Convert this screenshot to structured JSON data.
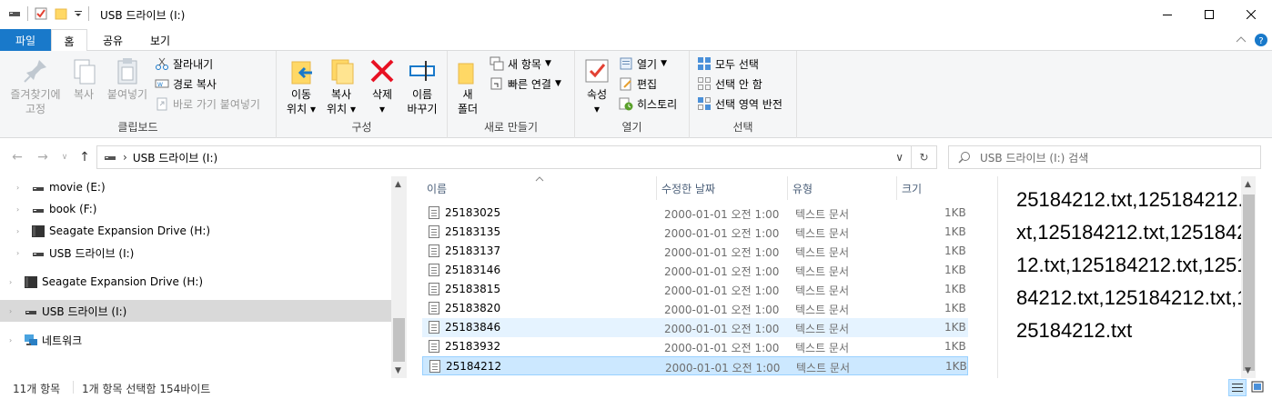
{
  "window": {
    "title": "USB 드라이브 (I:)"
  },
  "ribbon_tabs": [
    {
      "label": "파일"
    },
    {
      "label": "홈"
    },
    {
      "label": "공유"
    },
    {
      "label": "보기"
    }
  ],
  "clipboard": {
    "pin_label": "즐겨찾기에\n고정",
    "pin_line1": "즐겨찾기에",
    "pin_line2": "고정",
    "copy_label": "복사",
    "paste_label": "붙여넣기",
    "cut_label": "잘라내기",
    "copy_path_label": "경로 복사",
    "paste_shortcut_label": "바로 가기 붙여넣기",
    "group_label": "클립보드"
  },
  "organize": {
    "move_line1": "이동",
    "move_line2": "위치",
    "copyto_line1": "복사",
    "copyto_line2": "위치",
    "delete_label": "삭제",
    "rename_line1": "이름",
    "rename_line2": "바꾸기",
    "group_label": "구성"
  },
  "new": {
    "folder_line1": "새",
    "folder_line2": "폴더",
    "new_item_label": "새 항목",
    "easy_access_label": "빠른 연결",
    "group_label": "새로 만들기"
  },
  "open": {
    "properties_label": "속성",
    "open_label": "열기",
    "edit_label": "편집",
    "history_label": "히스토리",
    "group_label": "열기"
  },
  "select": {
    "select_all_label": "모두 선택",
    "select_none_label": "선택 안 함",
    "invert_label": "선택 영역 반전",
    "group_label": "선택"
  },
  "address": {
    "path": "USB 드라이브 (I:)",
    "search_placeholder": "USB 드라이브 (I:) 검색"
  },
  "nav_items": [
    {
      "label": "movie (E:)",
      "icon": "drive-icon"
    },
    {
      "label": "book (F:)",
      "icon": "drive-icon"
    },
    {
      "label": "Seagate Expansion Drive (H:)",
      "icon": "external-drive-icon"
    },
    {
      "label": "USB 드라이브 (I:)",
      "icon": "drive-icon"
    },
    {
      "label": "Seagate Expansion Drive (H:)",
      "icon": "external-drive-icon"
    },
    {
      "label": "USB 드라이브 (I:)",
      "icon": "drive-icon"
    },
    {
      "label": "네트워크",
      "icon": "network-icon"
    }
  ],
  "columns": {
    "name": "이름",
    "date": "수정한 날짜",
    "type": "유형",
    "size": "크기"
  },
  "files": [
    {
      "name": "25183025",
      "date": "2000-01-01 오전 1:00",
      "type": "텍스트 문서",
      "size": "1KB"
    },
    {
      "name": "25183135",
      "date": "2000-01-01 오전 1:00",
      "type": "텍스트 문서",
      "size": "1KB"
    },
    {
      "name": "25183137",
      "date": "2000-01-01 오전 1:00",
      "type": "텍스트 문서",
      "size": "1KB"
    },
    {
      "name": "25183146",
      "date": "2000-01-01 오전 1:00",
      "type": "텍스트 문서",
      "size": "1KB"
    },
    {
      "name": "25183815",
      "date": "2000-01-01 오전 1:00",
      "type": "텍스트 문서",
      "size": "1KB"
    },
    {
      "name": "25183820",
      "date": "2000-01-01 오전 1:00",
      "type": "텍스트 문서",
      "size": "1KB"
    },
    {
      "name": "25183846",
      "date": "2000-01-01 오전 1:00",
      "type": "텍스트 문서",
      "size": "1KB"
    },
    {
      "name": "25183932",
      "date": "2000-01-01 오전 1:00",
      "type": "텍스트 문서",
      "size": "1KB"
    },
    {
      "name": "25184212",
      "date": "2000-01-01 오전 1:00",
      "type": "텍스트 문서",
      "size": "1KB"
    }
  ],
  "preview": {
    "text": "25184212.txt,125184212.txt,125184212.txt,125184212.txt,125184212.txt,125184212.txt,125184212.txt,125184212.txt"
  },
  "status": {
    "item_count": "11개 항목",
    "selection": "1개 항목 선택함 154바이트"
  },
  "colors": {
    "file_tab": "#1979ca",
    "selection": "#cce8ff",
    "hover": "#e5f3ff",
    "delete_red": "#e81123"
  }
}
